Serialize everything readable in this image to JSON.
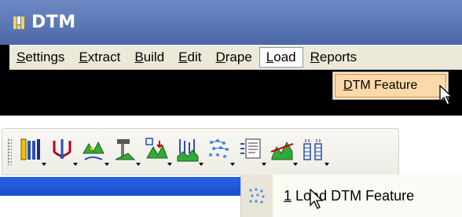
{
  "window": {
    "title": "DTM",
    "logo_icon": "microstation-logo-icon"
  },
  "menubar": {
    "items": [
      {
        "label_u": "S",
        "label_rest": "ettings"
      },
      {
        "label_u": "E",
        "label_rest": "xtract"
      },
      {
        "label_u": "B",
        "label_rest": "uild"
      },
      {
        "label_u": "E",
        "label_rest": "dit"
      },
      {
        "label_u": "D",
        "label_rest": "rape"
      },
      {
        "label_u": "L",
        "label_rest": "oad"
      },
      {
        "label_u": "R",
        "label_rest": "eports"
      }
    ],
    "active_index": 5
  },
  "load_menu": {
    "items": [
      {
        "label_u": "D",
        "label_rest": "TM Feature"
      }
    ]
  },
  "toolbar": {
    "tools": [
      "settings-tool-icon",
      "extract-tool-icon",
      "build-tool-icon",
      "edit-tool-icon",
      "drape-tool-icon",
      "profile-tool-icon",
      "load-dtm-feature-icon",
      "reports-tool-icon",
      "analysis-tool-icon",
      "numbering-tool-icon"
    ]
  },
  "popup_menu": {
    "number": "1",
    "label_rest": "Load DTM Feature",
    "icon": "load-dtm-feature-icon"
  },
  "colors": {
    "titlebar": "#5a76b4",
    "menu_bg": "#ece9d8",
    "highlight": "#fcd9a8",
    "strip": "#1a4fd0"
  }
}
